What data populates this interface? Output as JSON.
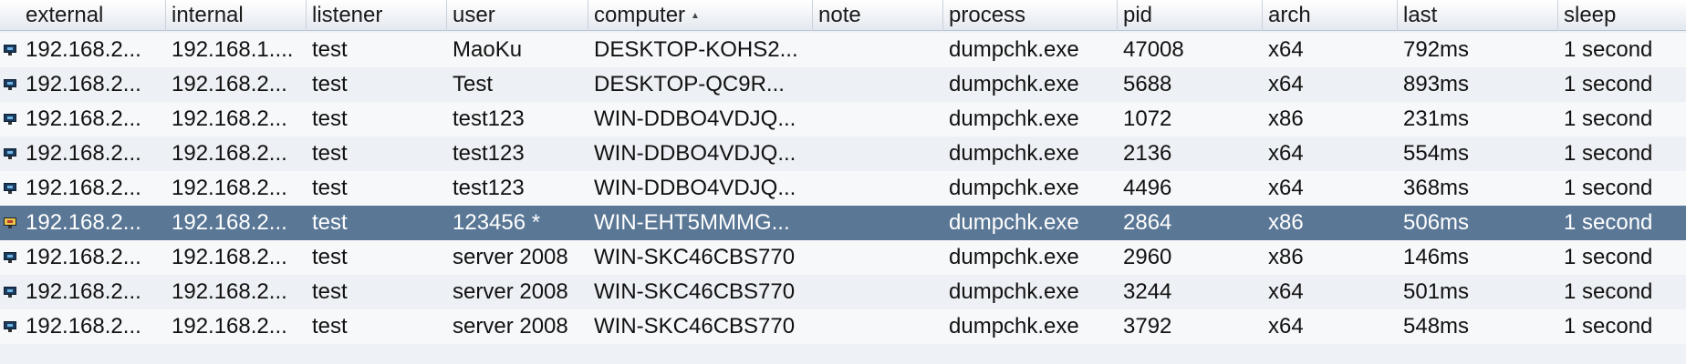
{
  "columns": {
    "external": "external",
    "internal": "internal",
    "listener": "listener",
    "user": "user",
    "computer": "computer",
    "note": "note",
    "process": "process",
    "pid": "pid",
    "arch": "arch",
    "last": "last",
    "sleep": "sleep"
  },
  "sort": {
    "column": "computer",
    "direction": "ascending",
    "icon": "sort-ascending-icon"
  },
  "rows": [
    {
      "external": "192.168.2...",
      "internal": "192.168.1....",
      "listener": "test",
      "user": "MaoKu",
      "computer": "DESKTOP-KOHS2...",
      "note": "",
      "process": "dumpchk.exe",
      "pid": "47008",
      "arch": "x64",
      "last": "792ms",
      "sleep": "1 second"
    },
    {
      "external": "192.168.2...",
      "internal": "192.168.2...",
      "listener": "test",
      "user": "Test",
      "computer": "DESKTOP-QC9R...",
      "note": "",
      "process": "dumpchk.exe",
      "pid": "5688",
      "arch": "x64",
      "last": "893ms",
      "sleep": "1 second"
    },
    {
      "external": "192.168.2...",
      "internal": "192.168.2...",
      "listener": "test",
      "user": "test123",
      "computer": "WIN-DDBO4VDJQ...",
      "note": "",
      "process": "dumpchk.exe",
      "pid": "1072",
      "arch": "x86",
      "last": "231ms",
      "sleep": "1 second"
    },
    {
      "external": "192.168.2...",
      "internal": "192.168.2...",
      "listener": "test",
      "user": "test123",
      "computer": "WIN-DDBO4VDJQ...",
      "note": "",
      "process": "dumpchk.exe",
      "pid": "2136",
      "arch": "x64",
      "last": "554ms",
      "sleep": "1 second"
    },
    {
      "external": "192.168.2...",
      "internal": "192.168.2...",
      "listener": "test",
      "user": "test123",
      "computer": "WIN-DDBO4VDJQ...",
      "note": "",
      "process": "dumpchk.exe",
      "pid": "4496",
      "arch": "x64",
      "last": "368ms",
      "sleep": "1 second"
    },
    {
      "external": "192.168.2...",
      "internal": "192.168.2...",
      "listener": "test",
      "user": "123456 *",
      "computer": "WIN-EHT5MMMG...",
      "note": "",
      "process": "dumpchk.exe",
      "pid": "2864",
      "arch": "x86",
      "last": "506ms",
      "sleep": "1 second",
      "selected": true
    },
    {
      "external": "192.168.2...",
      "internal": "192.168.2...",
      "listener": "test",
      "user": "server 2008",
      "computer": "WIN-SKC46CBS770",
      "note": "",
      "process": "dumpchk.exe",
      "pid": "2960",
      "arch": "x86",
      "last": "146ms",
      "sleep": "1 second"
    },
    {
      "external": "192.168.2...",
      "internal": "192.168.2...",
      "listener": "test",
      "user": "server 2008",
      "computer": "WIN-SKC46CBS770",
      "note": "",
      "process": "dumpchk.exe",
      "pid": "3244",
      "arch": "x64",
      "last": "501ms",
      "sleep": "1 second"
    },
    {
      "external": "192.168.2...",
      "internal": "192.168.2...",
      "listener": "test",
      "user": "server 2008",
      "computer": "WIN-SKC46CBS770",
      "note": "",
      "process": "dumpchk.exe",
      "pid": "3792",
      "arch": "x64",
      "last": "548ms",
      "sleep": "1 second"
    }
  ],
  "colors": {
    "selected_row": "#5a7796",
    "row_even": "#f7f8fa",
    "row_odd": "#edf0f4",
    "header": "#e4e9f0"
  },
  "row_icon": "beacon-session-icon"
}
